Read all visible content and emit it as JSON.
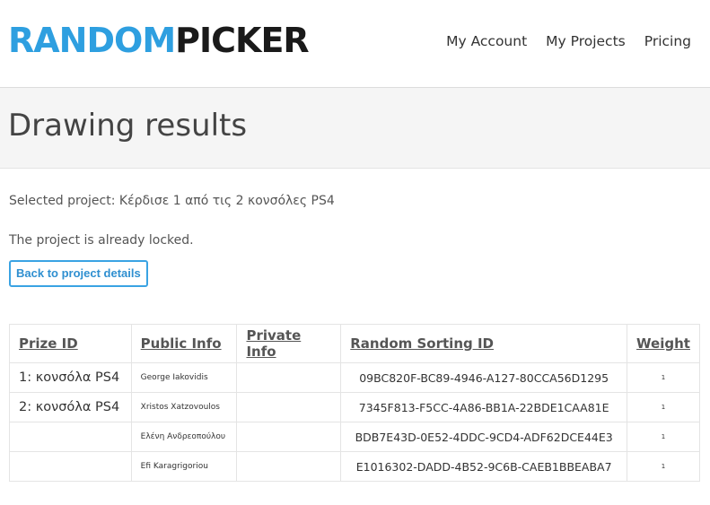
{
  "brand": {
    "part1": "RANDOM",
    "part2": "PICKER"
  },
  "nav": {
    "account": "My Account",
    "projects": "My Projects",
    "pricing": "Pricing"
  },
  "page": {
    "title": "Drawing results"
  },
  "info": {
    "selected": "Selected project: Κέρδισε 1 από τις 2 κονσόλες PS4",
    "locked": "The project is already locked."
  },
  "back_button": "Back to project details",
  "table": {
    "headers": {
      "prize_id": "Prize ID",
      "public_info": "Public Info",
      "private_info": "Private Info",
      "random_sorting_id": "Random Sorting ID",
      "weight": "Weight"
    },
    "rows": [
      {
        "prize": "1: κονσόλα PS4",
        "public": "George Iakovidis",
        "private": "",
        "rsid": "09BC820F-BC89-4946-A127-80CCA56D1295",
        "weight": "1"
      },
      {
        "prize": "2: κονσόλα PS4",
        "public": "Xristos Xatzovoulos",
        "private": "",
        "rsid": "7345F813-F5CC-4A86-BB1A-22BDE1CAA81E",
        "weight": "1"
      },
      {
        "prize": "",
        "public": "Ελένη Ανδρεοπούλου",
        "private": "",
        "rsid": "BDB7E43D-0E52-4DDC-9CD4-ADF62DCE44E3",
        "weight": "1"
      },
      {
        "prize": "",
        "public": "Efi Karagrigoriou",
        "private": "",
        "rsid": "E1016302-DADD-4B52-9C6B-CAEB1BBEABA7",
        "weight": "1"
      }
    ]
  },
  "colors": {
    "brand_blue": "#2e9fe0",
    "brand_dark": "#1a1a1a",
    "button_border": "#3aa3e3"
  }
}
